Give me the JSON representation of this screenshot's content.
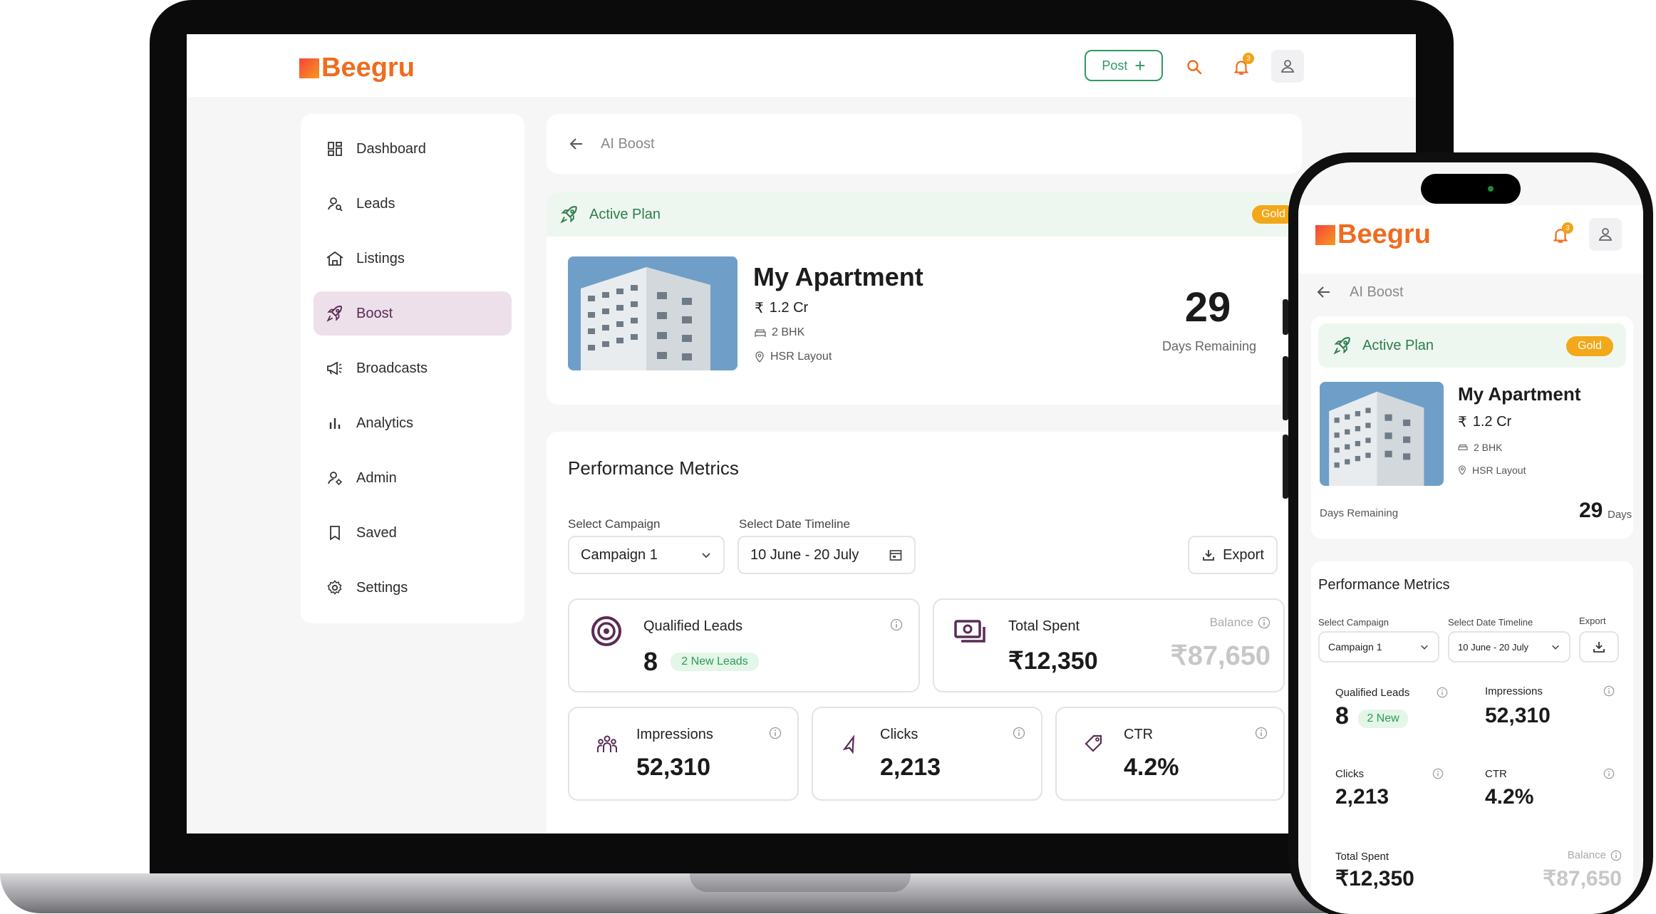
{
  "brand": {
    "name": "Beegru",
    "accent": "#ef6c1f",
    "green": "#2e9a62",
    "gold": "#f2a818",
    "purple": "#5a2b55"
  },
  "header": {
    "post_label": "Post",
    "notification_count": "3"
  },
  "sidebar": {
    "items": [
      {
        "label": "Dashboard",
        "icon": "dashboard-icon"
      },
      {
        "label": "Leads",
        "icon": "leads-icon"
      },
      {
        "label": "Listings",
        "icon": "listings-icon"
      },
      {
        "label": "Boost",
        "icon": "rocket-icon",
        "active": true
      },
      {
        "label": "Broadcasts",
        "icon": "megaphone-icon"
      },
      {
        "label": "Analytics",
        "icon": "bar-chart-icon"
      },
      {
        "label": "Admin",
        "icon": "admin-icon"
      },
      {
        "label": "Saved",
        "icon": "bookmark-icon"
      },
      {
        "label": "Settings",
        "icon": "gear-icon"
      }
    ]
  },
  "breadcrumb": {
    "label": "AI Boost"
  },
  "plan": {
    "status": "Active Plan",
    "tier": "Gold",
    "property_title": "My Apartment",
    "price": "1.2 Cr",
    "currency_symbol": "₹",
    "bhk": "2 BHK",
    "location": "HSR Layout",
    "days_remaining": "29",
    "days_remaining_label": "Days Remaining",
    "days_unit": "Days"
  },
  "metrics": {
    "title": "Performance Metrics",
    "campaign_label": "Select Campaign",
    "campaign_value": "Campaign 1",
    "date_label": "Select Date Timeline",
    "date_value": "10 June - 20 July",
    "export_label": "Export",
    "qualified_leads": {
      "label": "Qualified Leads",
      "value": "8",
      "badge": "2 New Leads",
      "badge_short": "2 New"
    },
    "total_spent": {
      "label": "Total Spent",
      "value": "₹12,350",
      "balance_label": "Balance",
      "balance_value": "₹87,650"
    },
    "impressions": {
      "label": "Impressions",
      "value": "52,310"
    },
    "clicks": {
      "label": "Clicks",
      "value": "2,213"
    },
    "ctr": {
      "label": "CTR",
      "value": "4.2%"
    }
  }
}
